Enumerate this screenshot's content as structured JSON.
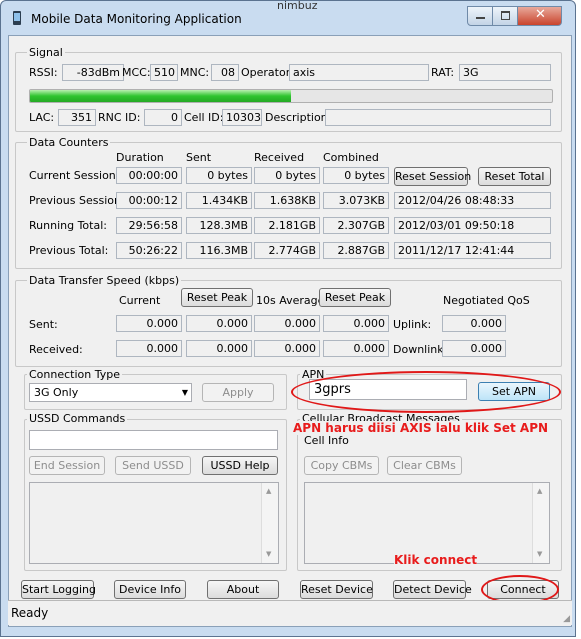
{
  "window": {
    "title": "Mobile Data Monitoring Application",
    "background_snippet": "nimbuz"
  },
  "signal": {
    "group": "Signal",
    "rssi_label": "RSSI:",
    "rssi": "-83dBm",
    "mcc_label": "MCC:",
    "mcc": "510",
    "mnc_label": "MNC:",
    "mnc": "08",
    "operator_label": "Operator:",
    "operator": "axis",
    "rat_label": "RAT:",
    "rat": "3G",
    "signal_strength": 0.5,
    "lac_label": "LAC:",
    "lac": "351",
    "rnc_label": "RNC ID:",
    "rnc": "0",
    "cell_label": "Cell ID:",
    "cell": "10303",
    "desc_label": "Description:",
    "desc": ""
  },
  "counters": {
    "group": "Data Counters",
    "headers": [
      "Duration",
      "Sent",
      "Received",
      "Combined"
    ],
    "rows": [
      {
        "label": "Current Session:",
        "values": [
          "00:00:00",
          "0 bytes",
          "0 bytes",
          "0 bytes"
        ]
      },
      {
        "label": "Previous Session:",
        "values": [
          "00:00:12",
          "1.434KB",
          "1.638KB",
          "3.073KB"
        ],
        "date": "2012/04/26 08:48:33"
      },
      {
        "label": "Running Total:",
        "values": [
          "29:56:58",
          "128.3MB",
          "2.181GB",
          "2.307GB"
        ],
        "date": "2012/03/01 09:50:18"
      },
      {
        "label": "Previous Total:",
        "values": [
          "50:26:22",
          "116.3MB",
          "2.774GB",
          "2.887GB"
        ],
        "date": "2011/12/17 12:41:44"
      }
    ],
    "reset_session": "Reset Session",
    "reset_total": "Reset Total"
  },
  "speed": {
    "group": "Data Transfer Speed (kbps)",
    "current": "Current",
    "avg": "10s Average",
    "negotiated": "Negotiated QoS",
    "reset_peak1": "Reset Peak",
    "reset_peak2": "Reset Peak",
    "sent_label": "Sent:",
    "received_label": "Received:",
    "uplink_label": "Uplink:",
    "downlink_label": "Downlink:",
    "sent": [
      "0.000",
      "0.000",
      "0.000",
      "0.000"
    ],
    "received": [
      "0.000",
      "0.000",
      "0.000",
      "0.000"
    ],
    "uplink": "0.000",
    "downlink": "0.000"
  },
  "connection": {
    "group": "Connection Type",
    "selected": "3G Only",
    "apply": "Apply"
  },
  "apn": {
    "group": "APN",
    "value": "3gprs",
    "set": "Set APN",
    "annotation": "APN harus diisi AXIS lalu klik Set APN"
  },
  "ussd": {
    "group": "USSD Commands",
    "end": "End Session",
    "send": "Send USSD",
    "help": "USSD Help"
  },
  "cbm": {
    "group": "Cellular Broadcast Messages",
    "cell_info": "Cell Info:",
    "copy": "Copy CBMs",
    "clear": "Clear CBMs"
  },
  "bottom": {
    "start": "Start Logging",
    "device_info": "Device Info",
    "about": "About",
    "reset_device": "Reset Device",
    "detect": "Detect Device",
    "connect": "Connect",
    "annotation": "Klik connect"
  },
  "status": "Ready"
}
